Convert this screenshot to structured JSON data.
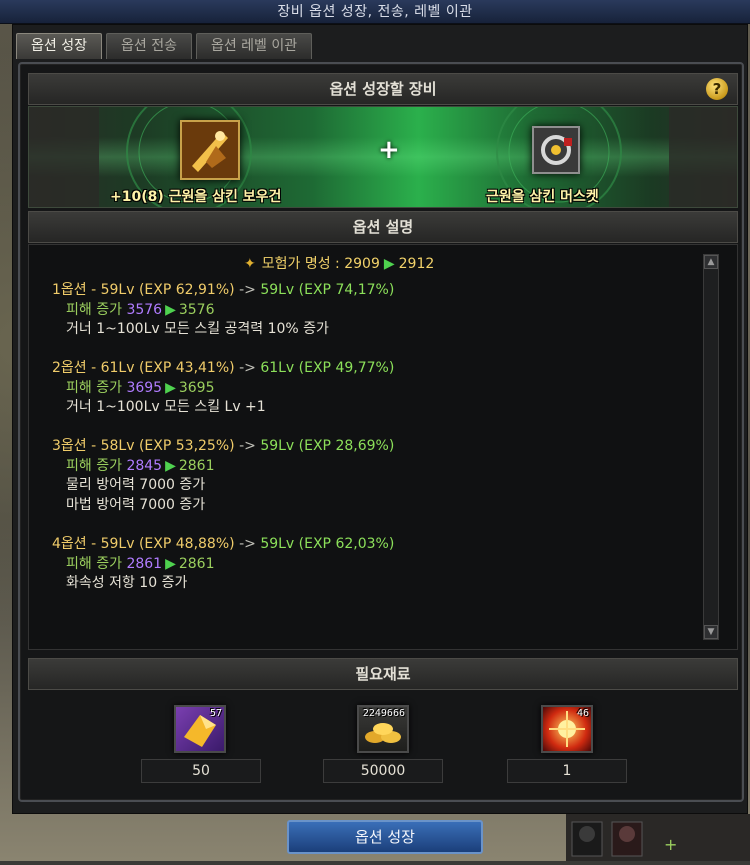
{
  "window_title": "장비 옵션 성장, 전송, 레벨 이관",
  "tabs": [
    {
      "label": "옵션 성장",
      "active": true
    },
    {
      "label": "옵션 전송",
      "active": false
    },
    {
      "label": "옵션 레벨 이관",
      "active": false
    }
  ],
  "equip_section": {
    "title": "옵션 성장할 장비",
    "help_icon": "?",
    "left_item": "+10(8) 근원을 삼킨 보우건",
    "plus": "+",
    "right_item": "근원을 삼킨 머스켓"
  },
  "desc_section": {
    "title": "옵션 설명",
    "fame_label": "모험가 명성 :",
    "fame_from": "2909",
    "fame_to": "2912",
    "options": [
      {
        "title_from": "1옵션 - 59Lv (EXP 62,91%)",
        "sep": "->",
        "title_to": "59Lv (EXP 74,17%)",
        "dmg_label": "피해 증가",
        "dmg_from": "3576",
        "dmg_to": "3576",
        "lines": [
          "거너 1~100Lv 모든 스킬 공격력 10% 증가"
        ]
      },
      {
        "title_from": "2옵션 - 61Lv (EXP 43,41%)",
        "sep": "->",
        "title_to": "61Lv (EXP 49,77%)",
        "dmg_label": "피해 증가",
        "dmg_from": "3695",
        "dmg_to": "3695",
        "lines": [
          "거너 1~100Lv 모든 스킬 Lv +1"
        ]
      },
      {
        "title_from": "3옵션 - 58Lv (EXP 53,25%)",
        "sep": "->",
        "title_to": "59Lv (EXP 28,69%)",
        "dmg_label": "피해 증가",
        "dmg_from": "2845",
        "dmg_to": "2861",
        "lines": [
          "물리 방어력 7000 증가",
          "마법 방어력 7000 증가"
        ]
      },
      {
        "title_from": "4옵션 - 59Lv (EXP 48,88%)",
        "sep": "->",
        "title_to": "59Lv (EXP 62,03%)",
        "dmg_label": "피해 증가",
        "dmg_from": "2861",
        "dmg_to": "2861",
        "lines": [
          "화속성 저항 10 증가"
        ]
      }
    ]
  },
  "materials_section": {
    "title": "필요재료",
    "items": [
      {
        "icon": "gold-crystal-icon",
        "badge": "57",
        "count": "50"
      },
      {
        "icon": "gold-coins-icon",
        "badge": "2249666",
        "count": "50000"
      },
      {
        "icon": "fire-orb-icon",
        "badge": "46",
        "count": "1"
      }
    ]
  },
  "action_button": "옵션 성장",
  "colors": {
    "title_gold": "#f0cc6a",
    "value_green": "#9bcf5e",
    "value_purple": "#b07cff",
    "arrow_green": "#4fd24f",
    "button_blue": "#2a5698"
  }
}
